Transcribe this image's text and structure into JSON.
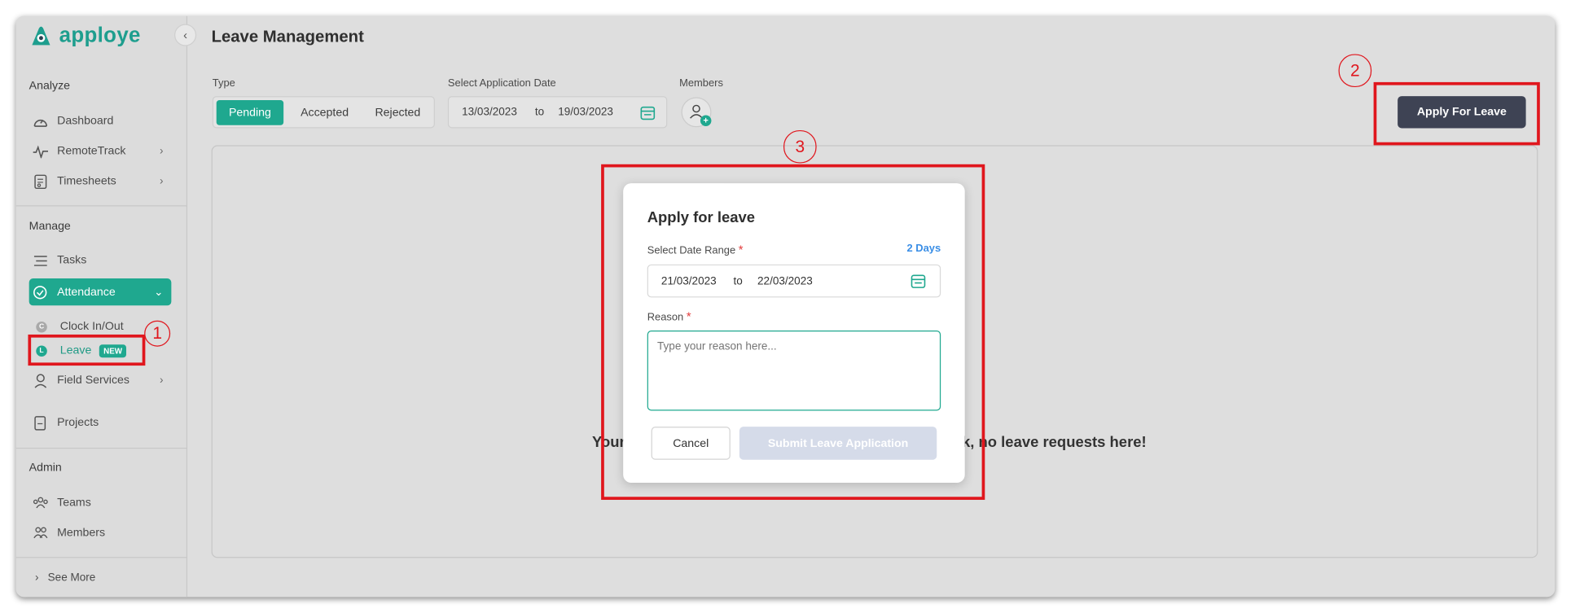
{
  "app": {
    "name": "apploye",
    "collapse_icon": "chevron-left-icon"
  },
  "sidebar": {
    "sections": [
      {
        "title": "Analyze"
      },
      {
        "title": "Manage"
      },
      {
        "title": "Admin"
      }
    ],
    "items": [
      {
        "label": "Dashboard",
        "icon": "dashboard-gauge-icon"
      },
      {
        "label": "RemoteTrack",
        "icon": "activity-pulse-icon"
      },
      {
        "label": "Timesheets",
        "icon": "timesheet-icon"
      },
      {
        "label": "Tasks",
        "icon": "list-icon"
      },
      {
        "label": "Attendance",
        "icon": "attendance-icon",
        "active": true
      },
      {
        "label": "Field Services",
        "icon": "location-person-icon"
      },
      {
        "label": "Projects",
        "icon": "document-icon"
      },
      {
        "label": "Teams",
        "icon": "teams-icon"
      },
      {
        "label": "Members",
        "icon": "members-icon"
      }
    ],
    "sub_items": [
      {
        "label": "Clock In/Out"
      },
      {
        "label": "Leave",
        "badge": "NEW"
      }
    ],
    "see_more": "See More"
  },
  "header": {
    "title": "Leave Management"
  },
  "filters": {
    "type_label": "Type",
    "type_options": [
      "Pending",
      "Accepted",
      "Rejected"
    ],
    "type_selected": "Pending",
    "date_label": "Select Application Date",
    "date_from": "13/03/2023",
    "date_sep": "to",
    "date_to": "19/03/2023",
    "members_label": "Members"
  },
  "apply_button": "Apply For Leave",
  "empty_state": {
    "left": "Your",
    "right": "k, no leave requests here!"
  },
  "modal": {
    "title": "Apply for leave",
    "date_range_label": "Select Date Range",
    "required_mark": "*",
    "days": "2 Days",
    "date_from": "21/03/2023",
    "date_sep": "to",
    "date_to": "22/03/2023",
    "reason_label": "Reason",
    "reason_placeholder": "Type your reason here...",
    "cancel": "Cancel",
    "submit": "Submit Leave Application"
  },
  "annotations": [
    "1",
    "2",
    "3"
  ],
  "colors": {
    "accent": "#1fa88f",
    "dark_button": "#3e4354",
    "annotation_red": "#e0161d",
    "link_blue": "#3a8ee6"
  }
}
